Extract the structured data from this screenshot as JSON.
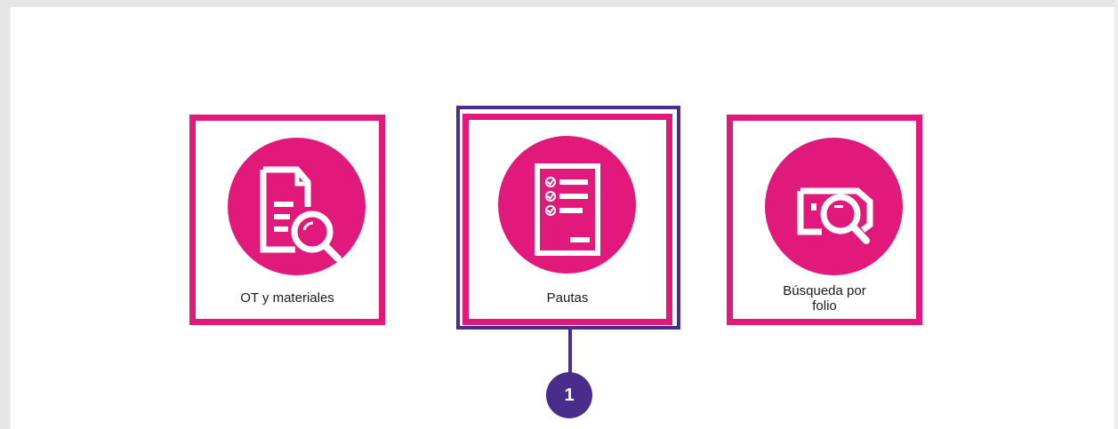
{
  "cards": [
    {
      "label": "OT y materiales",
      "icon": "document-search-icon"
    },
    {
      "label": "Pautas",
      "icon": "checklist-icon"
    },
    {
      "label": "Búsqueda por folio",
      "icon": "ticket-search-icon"
    }
  ],
  "callout": {
    "number": "1"
  },
  "colors": {
    "accent": "#e0197a",
    "highlight": "#4a2c8c",
    "frame": "#e6e6e6"
  }
}
